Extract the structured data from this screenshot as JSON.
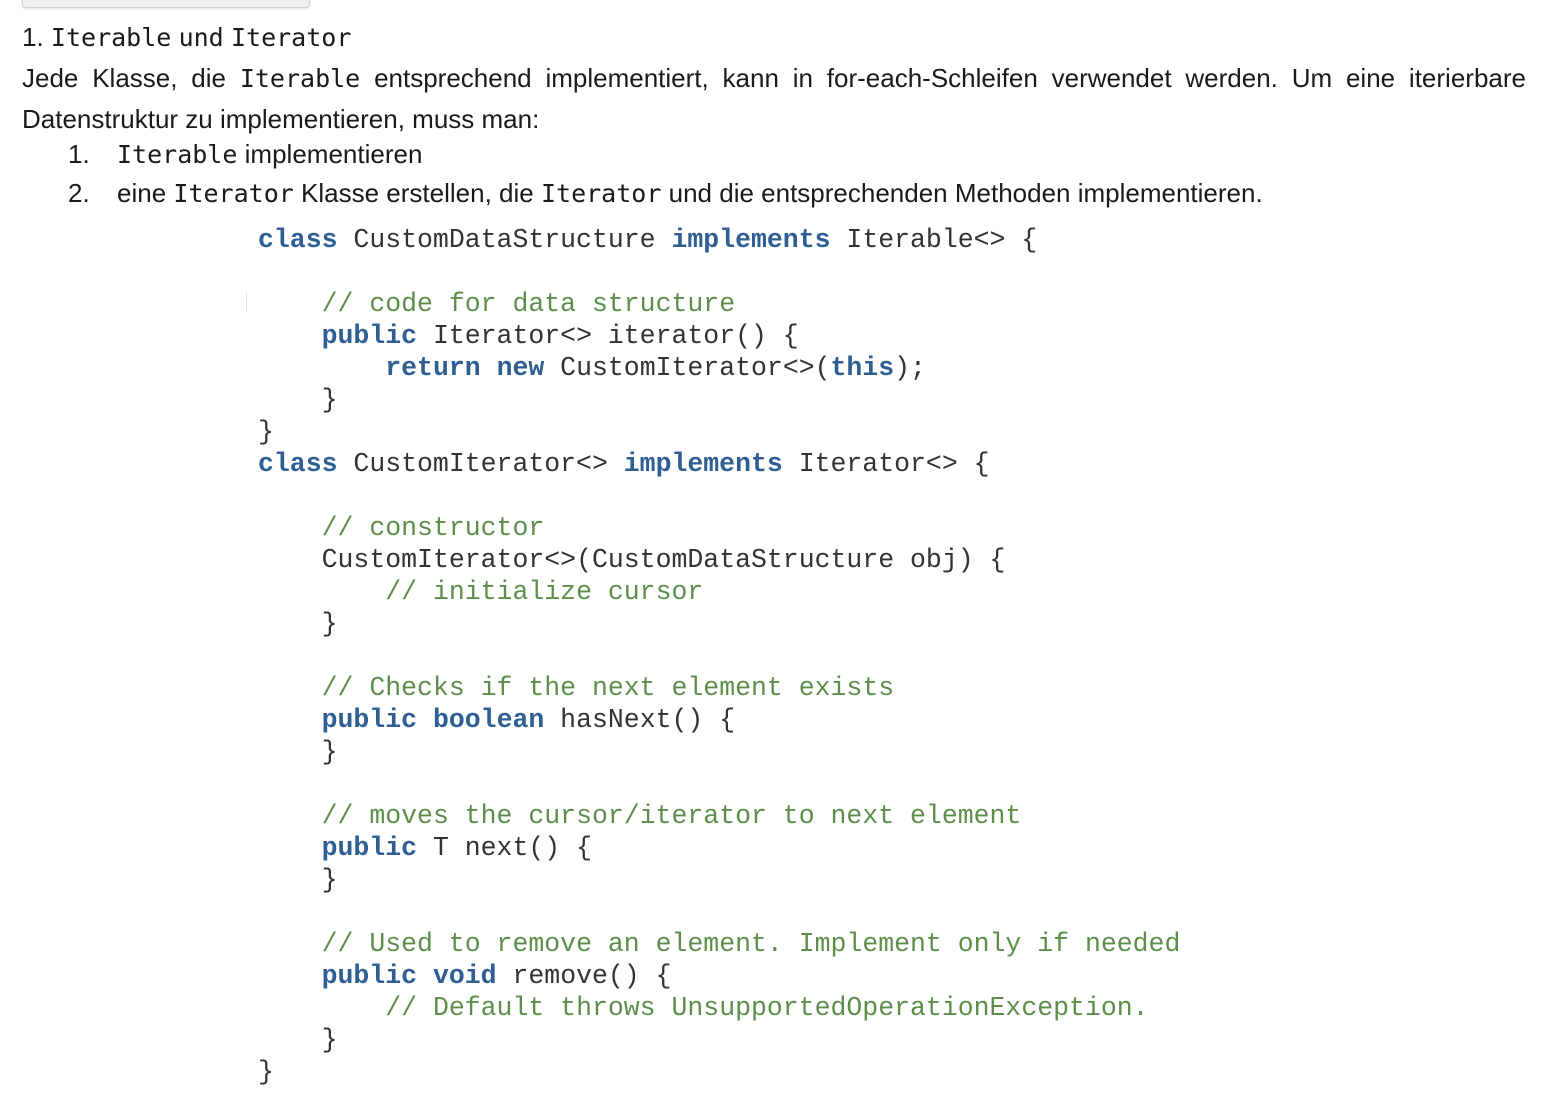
{
  "heading": {
    "number": "1.",
    "part1": "Iterable",
    "part2": "und",
    "part3": "Iterator"
  },
  "intro": {
    "t1": "Jede Klasse, die",
    "code1": "Iterable",
    "t2": "entsprechend implementiert, kann in for-each-Schleifen verwendet werden. Um eine iterierbare Datenstruktur zu implementieren, muss man:"
  },
  "steps": [
    {
      "num": "1.",
      "code": "Iterable",
      "text": "implementieren"
    },
    {
      "num": "2.",
      "text_before": "eine",
      "code1": "Iterator",
      "text_mid": "Klasse erstellen, die",
      "code2": "Iterator",
      "text_after": "und die entsprechenden Methoden implementieren."
    }
  ],
  "code": {
    "l1": {
      "k1": "class",
      "t1": " CustomDataStructure ",
      "k2": "implements",
      "t2": " Iterable<> {"
    },
    "l3": {
      "c": "// code for data structure"
    },
    "l4": {
      "k1": "public",
      "t1": " Iterator<> iterator() {"
    },
    "l5": {
      "k1": "return",
      "t1": " ",
      "k2": "new",
      "t2": " CustomIterator<>(",
      "k3": "this",
      "t3": ");"
    },
    "l6": {
      "t": "}"
    },
    "l7": {
      "t": "}"
    },
    "l8": {
      "k1": "class",
      "t1": " CustomIterator<> ",
      "k2": "implements",
      "t2": " Iterator<> {"
    },
    "l10": {
      "c": "// constructor"
    },
    "l11": {
      "t": "CustomIterator<>(CustomDataStructure obj) {"
    },
    "l12": {
      "c": "// initialize cursor"
    },
    "l13": {
      "t": "}"
    },
    "l15": {
      "c": "// Checks if the next element exists"
    },
    "l16": {
      "k1": "public",
      "t1": " ",
      "k2": "boolean",
      "t2": " hasNext() {"
    },
    "l17": {
      "t": "}"
    },
    "l19": {
      "c": "// moves the cursor/iterator to next element"
    },
    "l20": {
      "k1": "public",
      "t1": " T next() {"
    },
    "l21": {
      "t": "}"
    },
    "l23": {
      "c": "// Used to remove an element. Implement only if needed"
    },
    "l24": {
      "k1": "public",
      "t1": " ",
      "k2": "void",
      "t2": " remove() {"
    },
    "l25": {
      "c": "// Default throws UnsupportedOperationException."
    },
    "l26": {
      "t": "}"
    },
    "l27": {
      "t": "}"
    }
  }
}
